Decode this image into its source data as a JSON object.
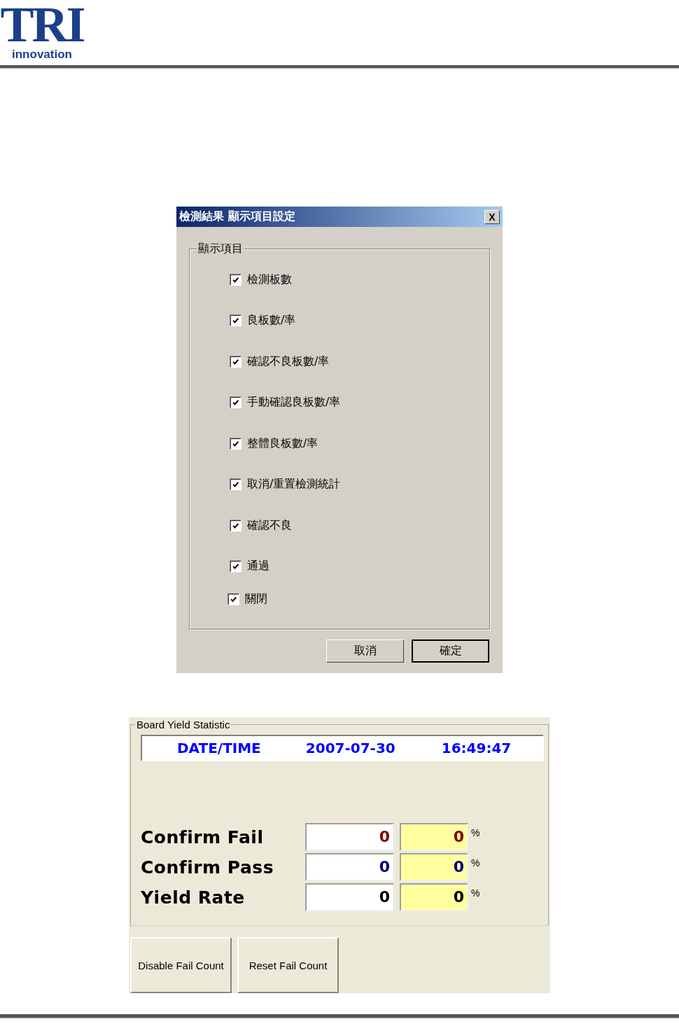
{
  "header": {
    "logo": {
      "mark": "TRI",
      "tagline": "innovation"
    }
  },
  "dialog": {
    "title": "檢測結果 顯示項目設定",
    "close": "X",
    "group": "顯示項目",
    "options": [
      {
        "label": "檢測板數",
        "checked": true
      },
      {
        "label": "良板數/率",
        "checked": true
      },
      {
        "label": "確認不良板數/率",
        "checked": true
      },
      {
        "label": "手動確認良板數/率",
        "checked": true
      },
      {
        "label": "整體良板數/率",
        "checked": true
      },
      {
        "label": "取消/重置檢測統計",
        "checked": true
      },
      {
        "label": "確認不良",
        "checked": true
      },
      {
        "label": "通過",
        "checked": true
      },
      {
        "label": "關閉",
        "checked": true
      }
    ],
    "buttons": [
      {
        "label": "取消",
        "default": false
      },
      {
        "label": "確定",
        "default": true
      }
    ]
  },
  "statistic": {
    "title": "Board Yield Statistic",
    "date_label": "DATE/TIME",
    "date": "2007-07-30",
    "time": "16:49:47",
    "rows": [
      {
        "label": "Confirm Fail",
        "count": "0",
        "rate": "0",
        "unit": "%",
        "color": "#800000"
      },
      {
        "label": "Confirm Pass",
        "count": "0",
        "rate": "0",
        "unit": "%",
        "color": "#000080"
      },
      {
        "label": "Yield Rate",
        "count": "0",
        "rate": "0",
        "unit": "%",
        "color": "#000000"
      }
    ],
    "buttons": [
      "Disable Fail Count",
      "Reset Fail Count"
    ]
  }
}
